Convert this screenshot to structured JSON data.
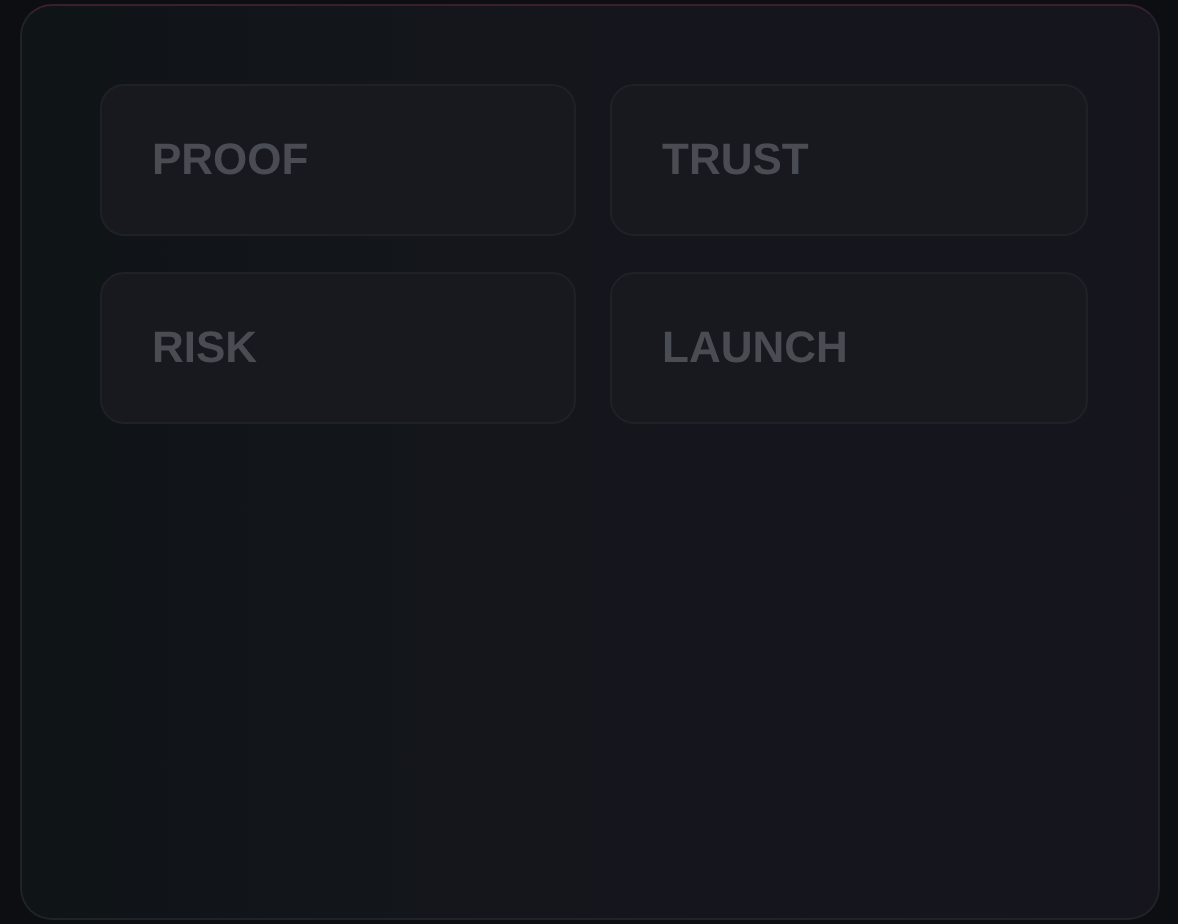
{
  "tiles": [
    {
      "label": "PROOF"
    },
    {
      "label": "TRUST"
    },
    {
      "label": "RISK"
    },
    {
      "label": "LAUNCH"
    }
  ]
}
